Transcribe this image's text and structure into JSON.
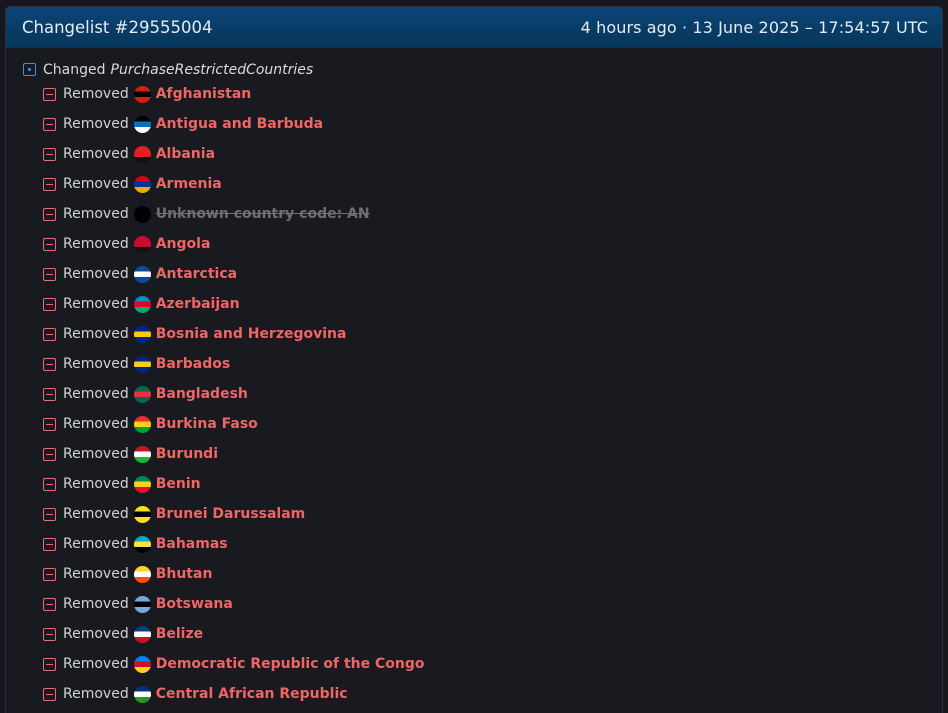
{
  "header": {
    "title": "Changelist #29555004",
    "timestamp": "4 hours ago · 13 June 2025 – 17:54:57 UTC"
  },
  "change": {
    "verb": "Changed",
    "key": "PurchaseRestrictedCountries"
  },
  "items": [
    {
      "verb": "Removed",
      "name": "Afghanistan",
      "flag": [
        "#d32011",
        "#000000",
        "#d32011"
      ],
      "unknown": false
    },
    {
      "verb": "Removed",
      "name": "Antigua and Barbuda",
      "flag": [
        "#000000",
        "#0072c6",
        "#ffffff"
      ],
      "unknown": false
    },
    {
      "verb": "Removed",
      "name": "Albania",
      "flag": [
        "#e41e20",
        "#e41e20",
        "#111111"
      ],
      "unknown": false
    },
    {
      "verb": "Removed",
      "name": "Armenia",
      "flag": [
        "#d90012",
        "#0033a0",
        "#f2a800"
      ],
      "unknown": false
    },
    {
      "verb": "Removed",
      "name": "Unknown country code: AN",
      "flag": [
        "#000000",
        "#000000",
        "#000000"
      ],
      "unknown": true
    },
    {
      "verb": "Removed",
      "name": "Angola",
      "flag": [
        "#cc092f",
        "#cc092f",
        "#111111"
      ],
      "unknown": false
    },
    {
      "verb": "Removed",
      "name": "Antarctica",
      "flag": [
        "#0a4a9e",
        "#ffffff",
        "#0a4a9e"
      ],
      "unknown": false
    },
    {
      "verb": "Removed",
      "name": "Azerbaijan",
      "flag": [
        "#0092bc",
        "#e4002b",
        "#00af66"
      ],
      "unknown": false
    },
    {
      "verb": "Removed",
      "name": "Bosnia and Herzegovina",
      "flag": [
        "#002395",
        "#fecb00",
        "#002395"
      ],
      "unknown": false
    },
    {
      "verb": "Removed",
      "name": "Barbados",
      "flag": [
        "#00267f",
        "#ffc726",
        "#00267f"
      ],
      "unknown": false
    },
    {
      "verb": "Removed",
      "name": "Bangladesh",
      "flag": [
        "#006a4e",
        "#f42a41",
        "#006a4e"
      ],
      "unknown": false
    },
    {
      "verb": "Removed",
      "name": "Burkina Faso",
      "flag": [
        "#ef2b2d",
        "#fcd116",
        "#009e49"
      ],
      "unknown": false
    },
    {
      "verb": "Removed",
      "name": "Burundi",
      "flag": [
        "#ce1126",
        "#ffffff",
        "#1eb53a"
      ],
      "unknown": false
    },
    {
      "verb": "Removed",
      "name": "Benin",
      "flag": [
        "#008751",
        "#fcd116",
        "#e8112d"
      ],
      "unknown": false
    },
    {
      "verb": "Removed",
      "name": "Brunei Darussalam",
      "flag": [
        "#f7e017",
        "#000000",
        "#f7e017"
      ],
      "unknown": false
    },
    {
      "verb": "Removed",
      "name": "Bahamas",
      "flag": [
        "#00abc9",
        "#fae042",
        "#000000"
      ],
      "unknown": false
    },
    {
      "verb": "Removed",
      "name": "Bhutan",
      "flag": [
        "#ffd520",
        "#ffffff",
        "#ff4e12"
      ],
      "unknown": false
    },
    {
      "verb": "Removed",
      "name": "Botswana",
      "flag": [
        "#75aadb",
        "#000000",
        "#75aadb"
      ],
      "unknown": false
    },
    {
      "verb": "Removed",
      "name": "Belize",
      "flag": [
        "#003f87",
        "#ffffff",
        "#ce1126"
      ],
      "unknown": false
    },
    {
      "verb": "Removed",
      "name": "Democratic Republic of the Congo",
      "flag": [
        "#007fff",
        "#ce1021",
        "#f7d618"
      ],
      "unknown": false
    },
    {
      "verb": "Removed",
      "name": "Central African Republic",
      "flag": [
        "#003082",
        "#ffffff",
        "#289728"
      ],
      "unknown": false
    }
  ],
  "colors": {
    "header_bg": "#063559",
    "removed_accent": "#f06565",
    "changed_accent": "#3c8fe6",
    "unknown_text": "#6d6f74"
  }
}
